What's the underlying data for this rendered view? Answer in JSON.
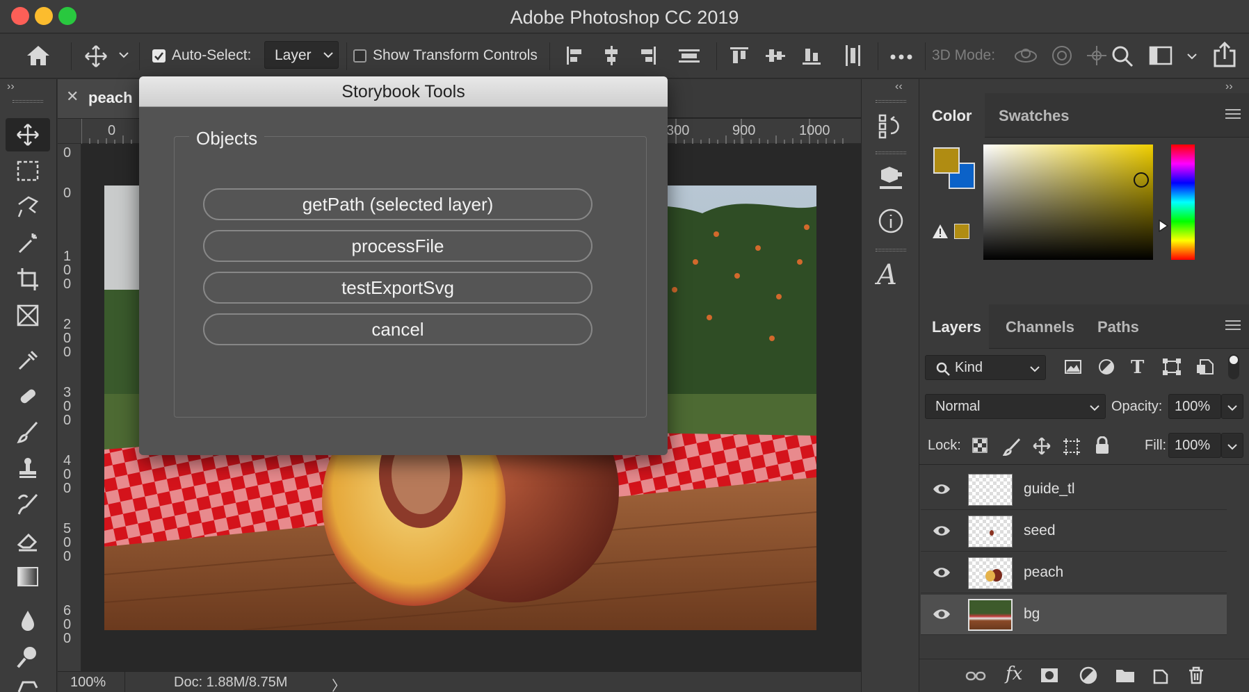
{
  "window": {
    "title": "Adobe Photoshop CC 2019"
  },
  "options_bar": {
    "auto_select_label": "Auto-Select:",
    "auto_select_checked": true,
    "auto_select_target": "Layer",
    "show_transform_label": "Show Transform Controls",
    "show_transform_checked": false,
    "mode_3d_label": "3D Mode:"
  },
  "document": {
    "tab_name": "peach",
    "ruler_top": [
      "0",
      "300",
      "900",
      "1000"
    ],
    "ruler_left": [
      "0",
      "0",
      "100",
      "200",
      "300",
      "400",
      "500",
      "600"
    ],
    "zoom": "100%",
    "doc_info": "Doc: 1.88M/8.75M",
    "status_arrow": "〉"
  },
  "color_panel": {
    "tabs": [
      "Color",
      "Swatches"
    ],
    "foreground": "#b08c12",
    "background": "#0b62c8"
  },
  "layers_panel": {
    "tabs": [
      "Layers",
      "Channels",
      "Paths"
    ],
    "filter_label": "Kind",
    "blend_mode": "Normal",
    "opacity_label": "Opacity:",
    "opacity_value": "100%",
    "lock_label": "Lock:",
    "fill_label": "Fill:",
    "fill_value": "100%",
    "layers": [
      {
        "name": "guide_tl",
        "selected": false
      },
      {
        "name": "seed",
        "selected": false
      },
      {
        "name": "peach",
        "selected": false
      },
      {
        "name": "bg",
        "selected": true
      }
    ]
  },
  "dialog": {
    "title": "Storybook Tools",
    "group_label": "Objects",
    "buttons": [
      "getPath (selected layer)",
      "processFile",
      "testExportSvg",
      "cancel"
    ]
  }
}
